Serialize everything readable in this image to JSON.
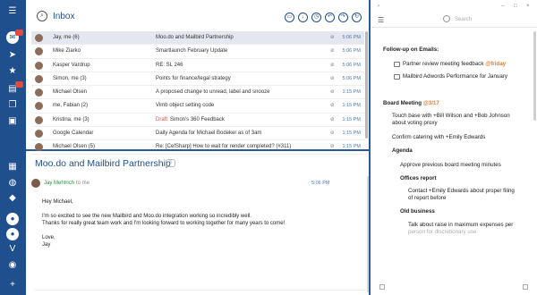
{
  "inbox": {
    "title": "Inbox",
    "toolbar_icons": [
      "archive-icon",
      "download-icon",
      "clock-icon",
      "reply-icon",
      "forward-icon",
      "refresh-icon"
    ],
    "rows": [
      {
        "sender": "Jay, me (6)",
        "draft": "",
        "subject": "Moo.do and Mailbird Partnership",
        "attachment": true,
        "time": "5:06 PM",
        "selected": true
      },
      {
        "sender": "Mike Ziarko",
        "draft": "",
        "subject": "Smartlaunch February Update",
        "attachment": true,
        "time": "5:06 PM",
        "selected": false
      },
      {
        "sender": "Kasper Vardrup",
        "draft": "",
        "subject": "RE: SL 246",
        "attachment": true,
        "time": "5:06 PM",
        "selected": false
      },
      {
        "sender": "Simon, me (3)",
        "draft": "",
        "subject": "Points for finance/legal strategy",
        "attachment": true,
        "time": "5:06 PM",
        "selected": false
      },
      {
        "sender": "Michael Olsen",
        "draft": "",
        "subject": "A proposed change to unread, label and snooze",
        "attachment": true,
        "time": "1:15 PM",
        "selected": false
      },
      {
        "sender": "me, Fabian (2)",
        "draft": "",
        "subject": "Vimb object setting code",
        "attachment": true,
        "time": "1:15 PM",
        "selected": false
      },
      {
        "sender": "Kristina, me (3)",
        "draft": "Draft",
        "subject": "Simon's 360 Feedback",
        "attachment": true,
        "time": "1:15 PM",
        "selected": false
      },
      {
        "sender": "Google Calendar",
        "draft": "",
        "subject": "Daily Agenda for Michael Bodeker as of 3am",
        "attachment": true,
        "time": "1:15 PM",
        "selected": false
      },
      {
        "sender": "Michael Olsen (5)",
        "draft": "",
        "subject": "Re: [CefSharp] How to wait for render completed? (#311)",
        "attachment": true,
        "time": "1:15 PM",
        "selected": false
      }
    ]
  },
  "reader": {
    "title": "Moo.do and Mailbird Partnership",
    "from": "Jay Mehtrich",
    "to": "to me",
    "time": "5:06 PM",
    "body": [
      "Hey Michael,",
      "",
      "I'm so excited to see the new Mailbird and Moo.do integration working so incredibly well.",
      "Thanks for really great team work and I'm looking forward to working together for many years to come!",
      "",
      "Love,",
      "Jay"
    ]
  },
  "tasks": {
    "search_placeholder": "Search",
    "followup_heading": "Follow-up on Emails:",
    "followup_items": [
      {
        "text": "Partner review meeting feedback",
        "tag": "@friday"
      },
      {
        "text": "Mailbird Adwords Performance for January",
        "tag": ""
      }
    ],
    "meeting_heading": "Board Meeting",
    "meeting_tag": "@3/17",
    "meeting_items": [
      {
        "text": "Touch base with +Bill Wilson and +Bob Johnson",
        "indent": 1,
        "bold": false
      },
      {
        "text": "about voting proxy",
        "indent": 1,
        "bold": false
      },
      {
        "text": "Confirm catering with +Emily Edwards",
        "indent": 1,
        "bold": false
      },
      {
        "text": "Agenda",
        "indent": 1,
        "bold": true
      },
      {
        "text": "Approve previous board meeting minutes",
        "indent": 2,
        "bold": false
      },
      {
        "text": "Offices report",
        "indent": 2,
        "bold": true
      },
      {
        "text": "Contact +Emily Edwards about proper filing",
        "indent": 3,
        "bold": false
      },
      {
        "text": "of report before",
        "indent": 3,
        "bold": false
      },
      {
        "text": "Old business",
        "indent": 2,
        "bold": true
      },
      {
        "text": "Talk about raise in maximum expenses per",
        "indent": 3,
        "bold": false
      },
      {
        "text": "person for discretionary use",
        "indent": 3,
        "bold": false
      }
    ]
  },
  "colors": {
    "brand": "#1f4f8c",
    "accent_tag": "#e07b2a",
    "draft": "#d9534f",
    "time": "#4a78b4",
    "from": "#2e8b3d"
  }
}
